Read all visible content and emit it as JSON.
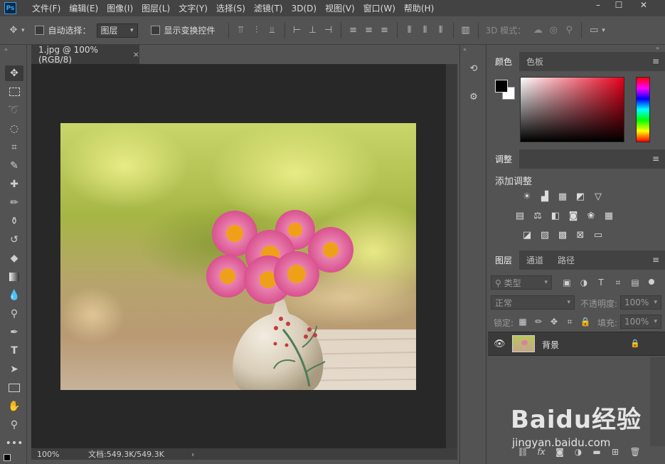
{
  "app": {
    "logo": "Ps"
  },
  "menu": [
    "文件(F)",
    "编辑(E)",
    "图像(I)",
    "图层(L)",
    "文字(Y)",
    "选择(S)",
    "滤镜(T)",
    "3D(D)",
    "视图(V)",
    "窗口(W)",
    "帮助(H)"
  ],
  "window_controls": {
    "minimize": "–",
    "maximize": "☐",
    "close": "✕"
  },
  "options": {
    "auto_select_label": "自动选择：",
    "auto_select_value": "图层",
    "show_transform_label": "显示变换控件",
    "mode_3d_label": "3D 模式："
  },
  "document": {
    "tab_title": "1.jpg @ 100%(RGB/8)",
    "tab_close": "×"
  },
  "status": {
    "zoom": "100%",
    "doc_info": "文档:549.3K/549.3K",
    "arrow": "›"
  },
  "color_panel": {
    "tabs": [
      "颜色",
      "色板"
    ],
    "fg_color": "#000000",
    "bg_color": "#ffffff"
  },
  "adjust_panel": {
    "tab": "调整",
    "title": "添加调整"
  },
  "layers_panel": {
    "tabs": [
      "图层",
      "通道",
      "路径"
    ],
    "filter_kind": "类型",
    "blend_mode": "正常",
    "opacity_label": "不透明度:",
    "opacity_value": "100%",
    "lock_label": "锁定:",
    "fill_label": "填充:",
    "fill_value": "100%",
    "layers": [
      {
        "name": "背景",
        "visible": true,
        "locked": true
      }
    ]
  },
  "watermark": {
    "brand": "Baidu经验",
    "url": "jingyan.baidu.com"
  },
  "colors": {
    "accent": "#31a8ff",
    "panel": "#535353",
    "canvas": "#282828"
  }
}
